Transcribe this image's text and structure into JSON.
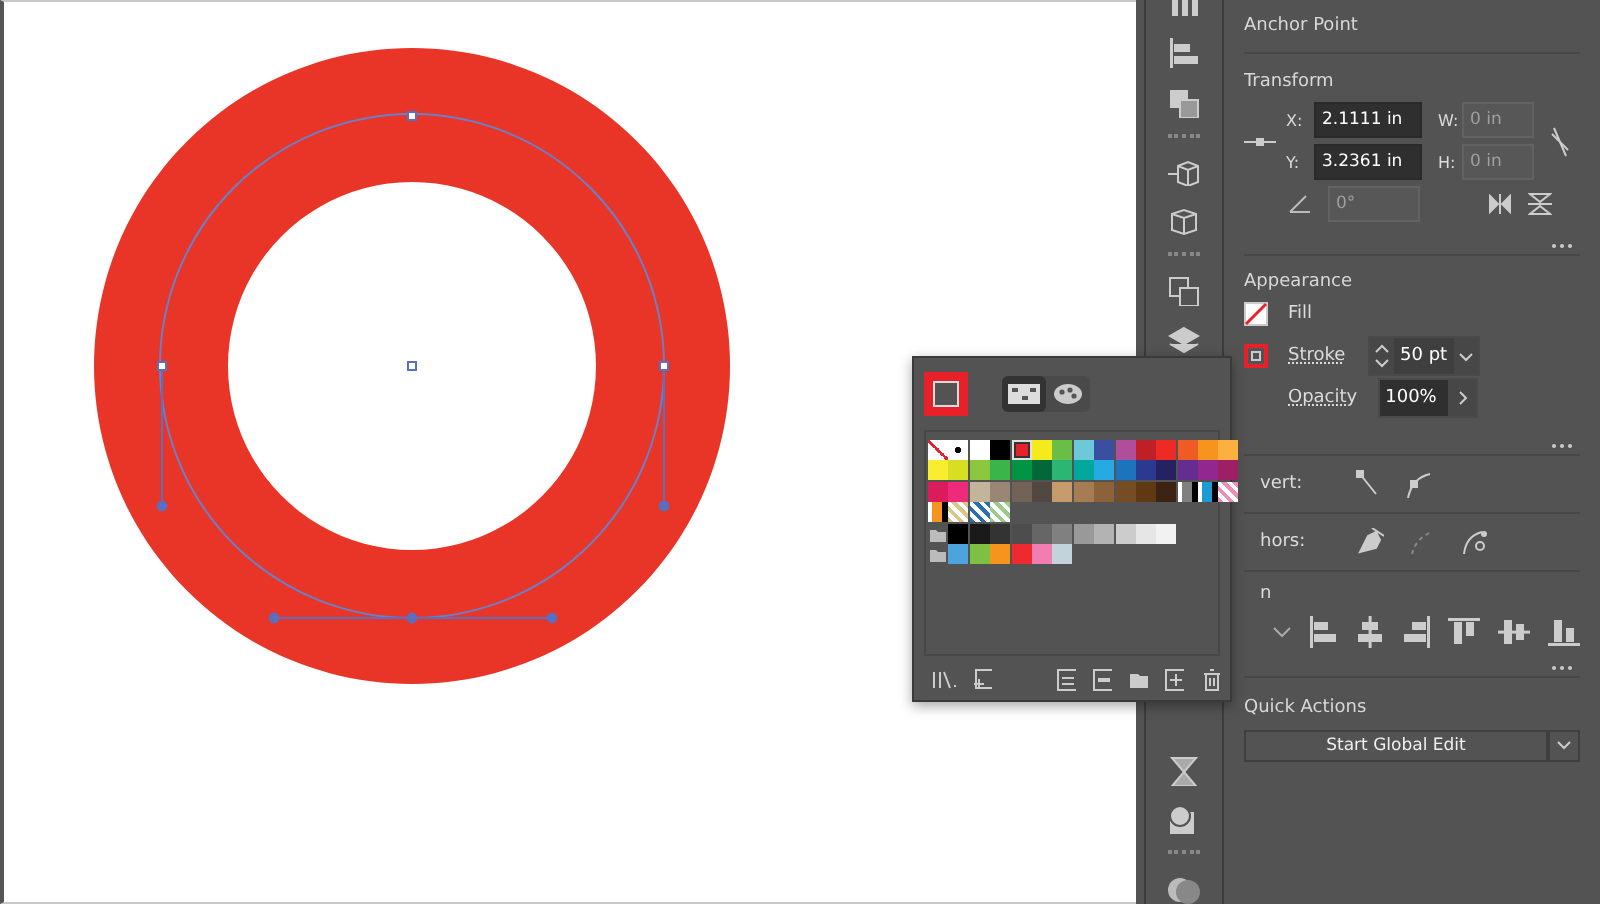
{
  "properties": {
    "anchor_point": {
      "title": "Anchor Point"
    },
    "transform": {
      "title": "Transform",
      "fields": [
        {
          "label": "X:",
          "value": "2.1111 in",
          "disabled": false
        },
        {
          "label": "W:",
          "value": "0 in",
          "disabled": true
        },
        {
          "label": "Y:",
          "value": "3.2361 in",
          "disabled": false
        },
        {
          "label": "H:",
          "value": "0 in",
          "disabled": true
        }
      ],
      "angle": {
        "value": "0°",
        "disabled": true
      }
    },
    "appearance": {
      "title": "Appearance",
      "fill": {
        "label": "Fill"
      },
      "stroke": {
        "label": "Stroke",
        "value": "50 pt"
      },
      "opacity": {
        "label": "Opacity",
        "value": "100%"
      }
    },
    "convert": {
      "label": "vert:"
    },
    "anchors": {
      "label": "hors:"
    },
    "align": {
      "title": "n"
    },
    "quick_actions": {
      "title": "Quick Actions",
      "button": "Start Global Edit"
    }
  },
  "swatches_popup": {
    "views": [
      {
        "kind": "grid",
        "selected": true
      },
      {
        "kind": "palette",
        "selected": false
      }
    ],
    "rows": [
      [
        {
          "kind": "none",
          "selected": false
        },
        {
          "kind": "registration",
          "selected": false
        },
        {
          "kind": "color",
          "color": "#ffffff",
          "selected": false
        },
        {
          "kind": "color",
          "color": "#000000",
          "selected": false
        },
        {
          "kind": "color",
          "color": "#e8202a",
          "selected": true
        },
        {
          "kind": "color",
          "color": "#f4ea1c",
          "selected": false
        },
        {
          "kind": "color",
          "color": "#6abd45",
          "selected": false
        },
        {
          "kind": "color",
          "color": "#6dc8d9",
          "selected": false
        },
        {
          "kind": "color",
          "color": "#3b4fa1",
          "selected": false
        },
        {
          "kind": "color",
          "color": "#b04e9c",
          "selected": false
        },
        {
          "kind": "color",
          "color": "#be2026",
          "selected": false
        },
        {
          "kind": "color",
          "color": "#ee2a24",
          "selected": false
        },
        {
          "kind": "color",
          "color": "#f05a24",
          "selected": false
        },
        {
          "kind": "color",
          "color": "#f7941d",
          "selected": false
        },
        {
          "kind": "color",
          "color": "#fbb040",
          "selected": false
        }
      ],
      [
        {
          "kind": "color",
          "color": "#f9ed32",
          "selected": false
        },
        {
          "kind": "color",
          "color": "#d7df23",
          "selected": false
        },
        {
          "kind": "color",
          "color": "#8dc63f",
          "selected": false
        },
        {
          "kind": "color",
          "color": "#39b54a",
          "selected": false
        },
        {
          "kind": "color",
          "color": "#009444",
          "selected": false
        },
        {
          "kind": "color",
          "color": "#006838",
          "selected": false
        },
        {
          "kind": "color",
          "color": "#2bb673",
          "selected": false
        },
        {
          "kind": "color",
          "color": "#00a79d",
          "selected": false
        },
        {
          "kind": "color",
          "color": "#27aae1",
          "selected": false
        },
        {
          "kind": "color",
          "color": "#1c75bc",
          "selected": false
        },
        {
          "kind": "color",
          "color": "#2b3990",
          "selected": false
        },
        {
          "kind": "color",
          "color": "#262262",
          "selected": false
        },
        {
          "kind": "color",
          "color": "#662d91",
          "selected": false
        },
        {
          "kind": "color",
          "color": "#92278f",
          "selected": false
        },
        {
          "kind": "color",
          "color": "#9e1f63",
          "selected": false
        }
      ],
      [
        {
          "kind": "color",
          "color": "#da1c5c",
          "selected": false
        },
        {
          "kind": "color",
          "color": "#ee2a7b",
          "selected": false
        },
        {
          "kind": "color",
          "color": "#c2b59b",
          "selected": false
        },
        {
          "kind": "color",
          "color": "#998675",
          "selected": false
        },
        {
          "kind": "color",
          "color": "#736357",
          "selected": false
        },
        {
          "kind": "color",
          "color": "#534741",
          "selected": false
        },
        {
          "kind": "color",
          "color": "#c69c6d",
          "selected": false
        },
        {
          "kind": "color",
          "color": "#a67c52",
          "selected": false
        },
        {
          "kind": "color",
          "color": "#8c6239",
          "selected": false
        },
        {
          "kind": "color",
          "color": "#754c24",
          "selected": false
        },
        {
          "kind": "color",
          "color": "#603813",
          "selected": false
        },
        {
          "kind": "color",
          "color": "#3c2415",
          "selected": false
        },
        {
          "kind": "gradient",
          "color": "#808080",
          "selected": false
        },
        {
          "kind": "gradient",
          "color": "#1c9ad6",
          "selected": false
        },
        {
          "kind": "pattern",
          "color": "#f08cb8",
          "selected": false
        }
      ],
      [
        {
          "kind": "gradient",
          "color": "#f7941d",
          "selected": false
        },
        {
          "kind": "pattern",
          "color": "#d8c888",
          "selected": false
        },
        {
          "kind": "pattern",
          "color": "#2a6fb0",
          "selected": false
        },
        {
          "kind": "pattern",
          "color": "#9ccc8c",
          "selected": false
        }
      ],
      [
        {
          "kind": "folder"
        },
        {
          "kind": "color",
          "color": "#000000",
          "selected": false
        },
        {
          "kind": "color",
          "color": "#1a1a1a",
          "selected": false
        },
        {
          "kind": "color",
          "color": "#333333",
          "selected": false
        },
        {
          "kind": "color",
          "color": "#4d4d4d",
          "selected": false
        },
        {
          "kind": "color",
          "color": "#666666",
          "selected": false
        },
        {
          "kind": "color",
          "color": "#808080",
          "selected": false
        },
        {
          "kind": "color",
          "color": "#999999",
          "selected": false
        },
        {
          "kind": "color",
          "color": "#b3b3b3",
          "selected": false
        },
        {
          "kind": "color",
          "color": "#cccccc",
          "selected": false
        },
        {
          "kind": "color",
          "color": "#e6e6e6",
          "selected": false
        },
        {
          "kind": "color",
          "color": "#f2f2f2",
          "selected": false
        }
      ],
      [
        {
          "kind": "folder"
        },
        {
          "kind": "color",
          "color": "#4da3dd",
          "selected": false
        },
        {
          "kind": "color",
          "color": "#7dc142",
          "selected": false
        },
        {
          "kind": "color",
          "color": "#f7941d",
          "selected": false
        },
        {
          "kind": "color",
          "color": "#ee2a30",
          "selected": false
        },
        {
          "kind": "color",
          "color": "#f07eb0",
          "selected": false
        },
        {
          "kind": "color",
          "color": "#c3d3dc",
          "selected": false
        }
      ]
    ]
  }
}
